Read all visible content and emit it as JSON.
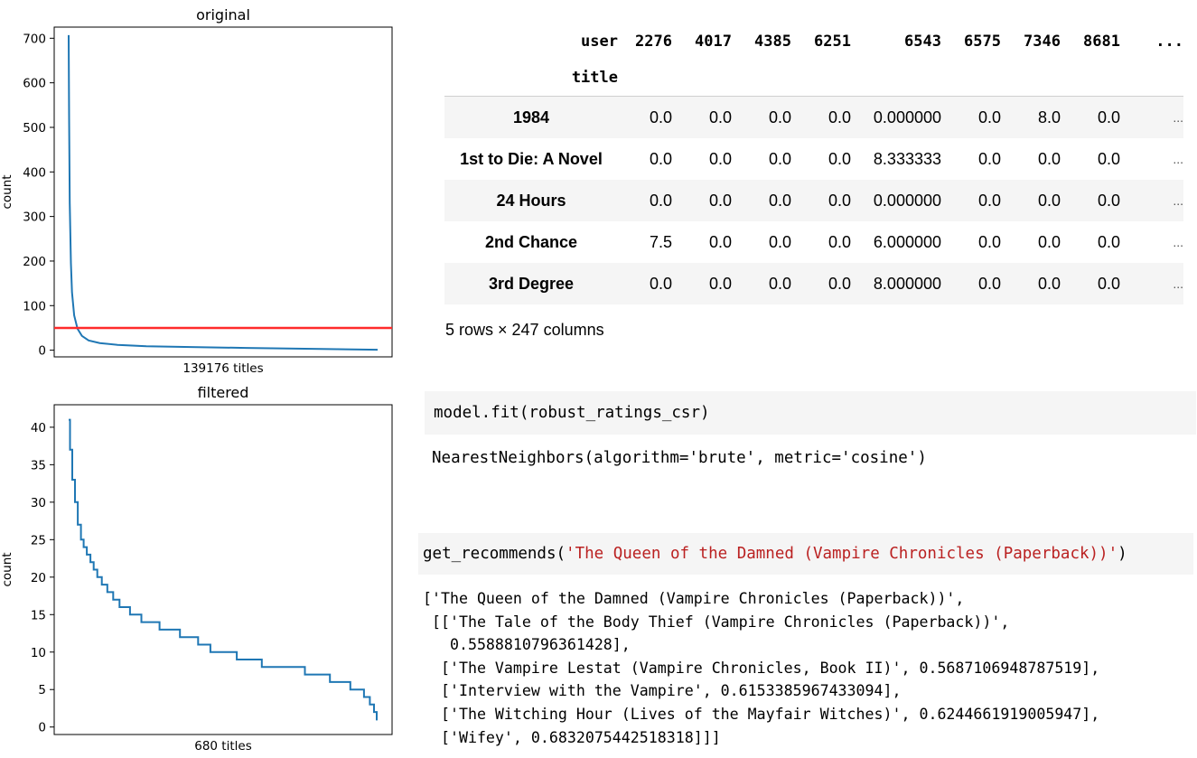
{
  "charts": {
    "chart_data": [
      {
        "type": "line",
        "title": "original",
        "xlabel": "139176 titles",
        "ylabel": "count",
        "ylim": [
          -15,
          725
        ],
        "yticks": [
          0,
          100,
          200,
          300,
          400,
          500,
          600,
          700
        ],
        "x_count": 139176,
        "line_color": "#1f77b4",
        "threshold": 50,
        "threshold_color": "#ff2b2b",
        "grid": false,
        "points": [
          [
            0,
            707
          ],
          [
            200,
            520
          ],
          [
            500,
            330
          ],
          [
            1000,
            195
          ],
          [
            1500,
            130
          ],
          [
            2500,
            78
          ],
          [
            4000,
            48
          ],
          [
            6000,
            32
          ],
          [
            9000,
            22
          ],
          [
            14000,
            16
          ],
          [
            22000,
            12
          ],
          [
            35000,
            9
          ],
          [
            55000,
            7
          ],
          [
            80000,
            5
          ],
          [
            110000,
            3
          ],
          [
            139176,
            1
          ]
        ]
      },
      {
        "type": "line",
        "title": "filtered",
        "xlabel": "680 titles",
        "ylabel": "count",
        "ylim": [
          -1,
          43
        ],
        "yticks": [
          0,
          5,
          10,
          15,
          20,
          25,
          30,
          35,
          40
        ],
        "x_count": 680,
        "line_color": "#1f77b4",
        "grid": false,
        "steps": [
          [
            0,
            41
          ],
          [
            3,
            37
          ],
          [
            8,
            33
          ],
          [
            14,
            30
          ],
          [
            20,
            27
          ],
          [
            27,
            25
          ],
          [
            33,
            24
          ],
          [
            40,
            23
          ],
          [
            48,
            22
          ],
          [
            55,
            21
          ],
          [
            63,
            20
          ],
          [
            73,
            19
          ],
          [
            85,
            18
          ],
          [
            98,
            17
          ],
          [
            112,
            16
          ],
          [
            135,
            15
          ],
          [
            160,
            14
          ],
          [
            200,
            13
          ],
          [
            245,
            12
          ],
          [
            285,
            11
          ],
          [
            312,
            10
          ],
          [
            370,
            9
          ],
          [
            425,
            8
          ],
          [
            520,
            7
          ],
          [
            575,
            6
          ],
          [
            620,
            5
          ],
          [
            650,
            4
          ],
          [
            663,
            3
          ],
          [
            672,
            2
          ],
          [
            678,
            1
          ]
        ]
      }
    ]
  },
  "dataframe": {
    "columns_header": "user",
    "index_name": "title",
    "columns": [
      "2276",
      "4017",
      "4385",
      "6251",
      "6543",
      "6575",
      "7346",
      "8681",
      "..."
    ],
    "rows": [
      {
        "title": "1984",
        "values": [
          "0.0",
          "0.0",
          "0.0",
          "0.0",
          "0.000000",
          "0.0",
          "8.0",
          "0.0",
          "..."
        ]
      },
      {
        "title": "1st to Die: A Novel",
        "values": [
          "0.0",
          "0.0",
          "0.0",
          "0.0",
          "8.333333",
          "0.0",
          "0.0",
          "0.0",
          "..."
        ]
      },
      {
        "title": "24 Hours",
        "values": [
          "0.0",
          "0.0",
          "0.0",
          "0.0",
          "0.000000",
          "0.0",
          "0.0",
          "0.0",
          "..."
        ]
      },
      {
        "title": "2nd Chance",
        "values": [
          "7.5",
          "0.0",
          "0.0",
          "0.0",
          "6.000000",
          "0.0",
          "0.0",
          "0.0",
          "..."
        ]
      },
      {
        "title": "3rd Degree",
        "values": [
          "0.0",
          "0.0",
          "0.0",
          "0.0",
          "8.000000",
          "0.0",
          "0.0",
          "0.0",
          "..."
        ]
      }
    ],
    "shape_text": "5 rows × 247 columns"
  },
  "cells": {
    "fit_code": "model.fit(robust_ratings_csr)",
    "fit_output": "NearestNeighbors(algorithm='brute', metric='cosine')",
    "rec_code_func": "get_recommends(",
    "rec_code_arg": "'The Queen of the Damned (Vampire Chronicles (Paperback))'",
    "rec_code_close": ")",
    "rec_output_lines": [
      "['The Queen of the Damned (Vampire Chronicles (Paperback))',",
      " [['The Tale of the Body Thief (Vampire Chronicles (Paperback))',",
      "   0.5588810796361428],",
      "  ['The Vampire Lestat (Vampire Chronicles, Book II)', 0.5687106948787519],",
      "  ['Interview with the Vampire', 0.6153385967433094],",
      "  ['The Witching Hour (Lives of the Mayfair Witches)', 0.6244661919005947],",
      "  ['Wifey', 0.6832075442518318]]]"
    ]
  }
}
